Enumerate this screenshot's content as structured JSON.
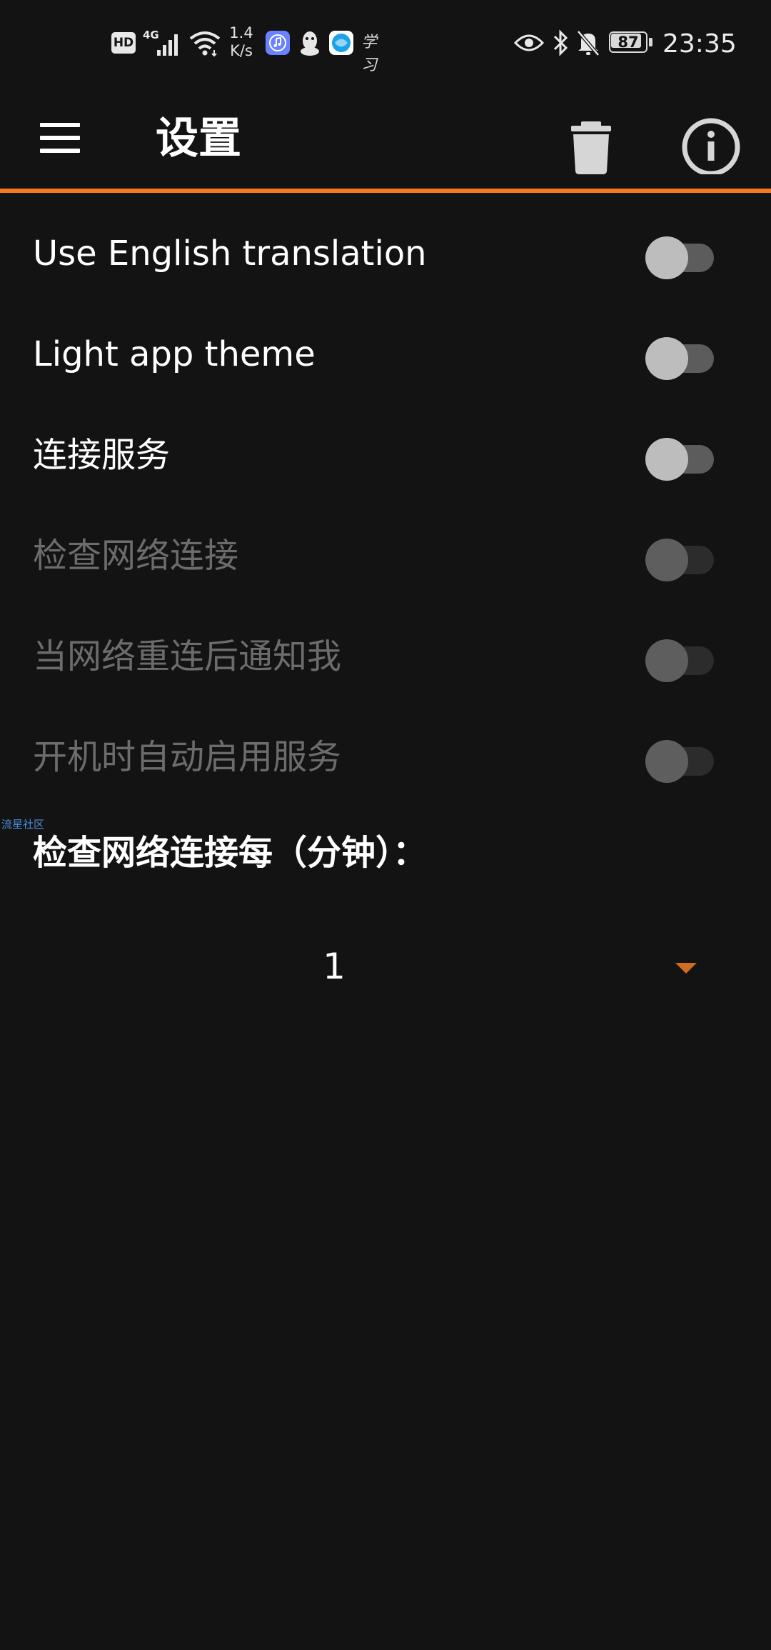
{
  "status_bar": {
    "hd_label": "HD",
    "network_type": "4G",
    "speed_value": "1.4",
    "speed_unit": "K/s",
    "xuexi_label": "学习",
    "battery_level": 87,
    "battery_text": "87",
    "time": "23:35"
  },
  "toolbar": {
    "title": "设置",
    "menu_icon": "hamburger-menu-icon",
    "delete_icon": "trash-icon",
    "info_icon": "info-icon"
  },
  "colors": {
    "background": "#131313",
    "accent": "#f37a1f",
    "spinner_arrow": "#cf6c22",
    "disabled_text": "#6c6c6c"
  },
  "settings": [
    {
      "label": "Use English translation",
      "enabled": true,
      "checked": false
    },
    {
      "label": "Light app theme",
      "enabled": true,
      "checked": false
    },
    {
      "label": "连接服务",
      "enabled": true,
      "checked": false
    },
    {
      "label": "检查网络连接",
      "enabled": false,
      "checked": false
    },
    {
      "label": "当网络重连后通知我",
      "enabled": false,
      "checked": false
    },
    {
      "label": "开机时自动启用服务",
      "enabled": false,
      "checked": false
    }
  ],
  "watermark": "流星社区",
  "interval": {
    "label": "检查网络连接每（分钟）：",
    "value": "1"
  }
}
